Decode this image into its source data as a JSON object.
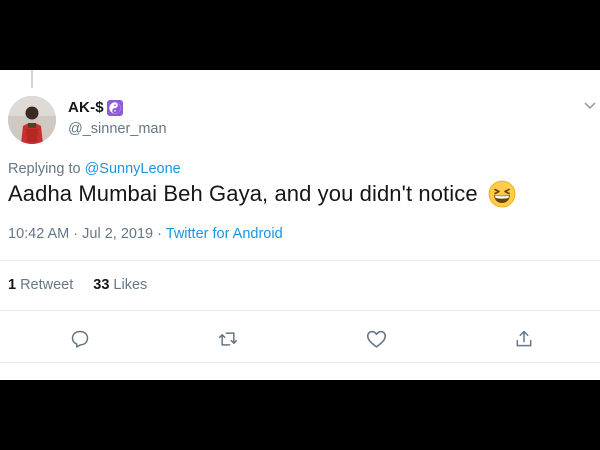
{
  "tweet": {
    "author": {
      "display_name": "AK-$",
      "badge_icon": "yin-yang-emoji-icon",
      "handle": "@_sinner_man"
    },
    "replying_prefix": "Replying to",
    "replying_mention": "@SunnyLeone",
    "text": "Aadha Mumbai Beh Gaya, and you didn't notice",
    "emoji_icon": "grinning-squinting-face-icon",
    "time": "10:42 AM",
    "separator": "·",
    "date": "Jul 2, 2019",
    "client": "Twitter for Android",
    "stats": {
      "retweets_count": "1",
      "retweets_label": "Retweet",
      "likes_count": "33",
      "likes_label": "Likes"
    },
    "actions": [
      "reply-icon",
      "retweet-icon",
      "like-icon",
      "share-icon"
    ]
  },
  "colors": {
    "primary_text": "#14171a",
    "secondary_text": "#657786",
    "link": "#1b95e0",
    "divider": "#e6ecf0",
    "letterbox": "#000000"
  }
}
